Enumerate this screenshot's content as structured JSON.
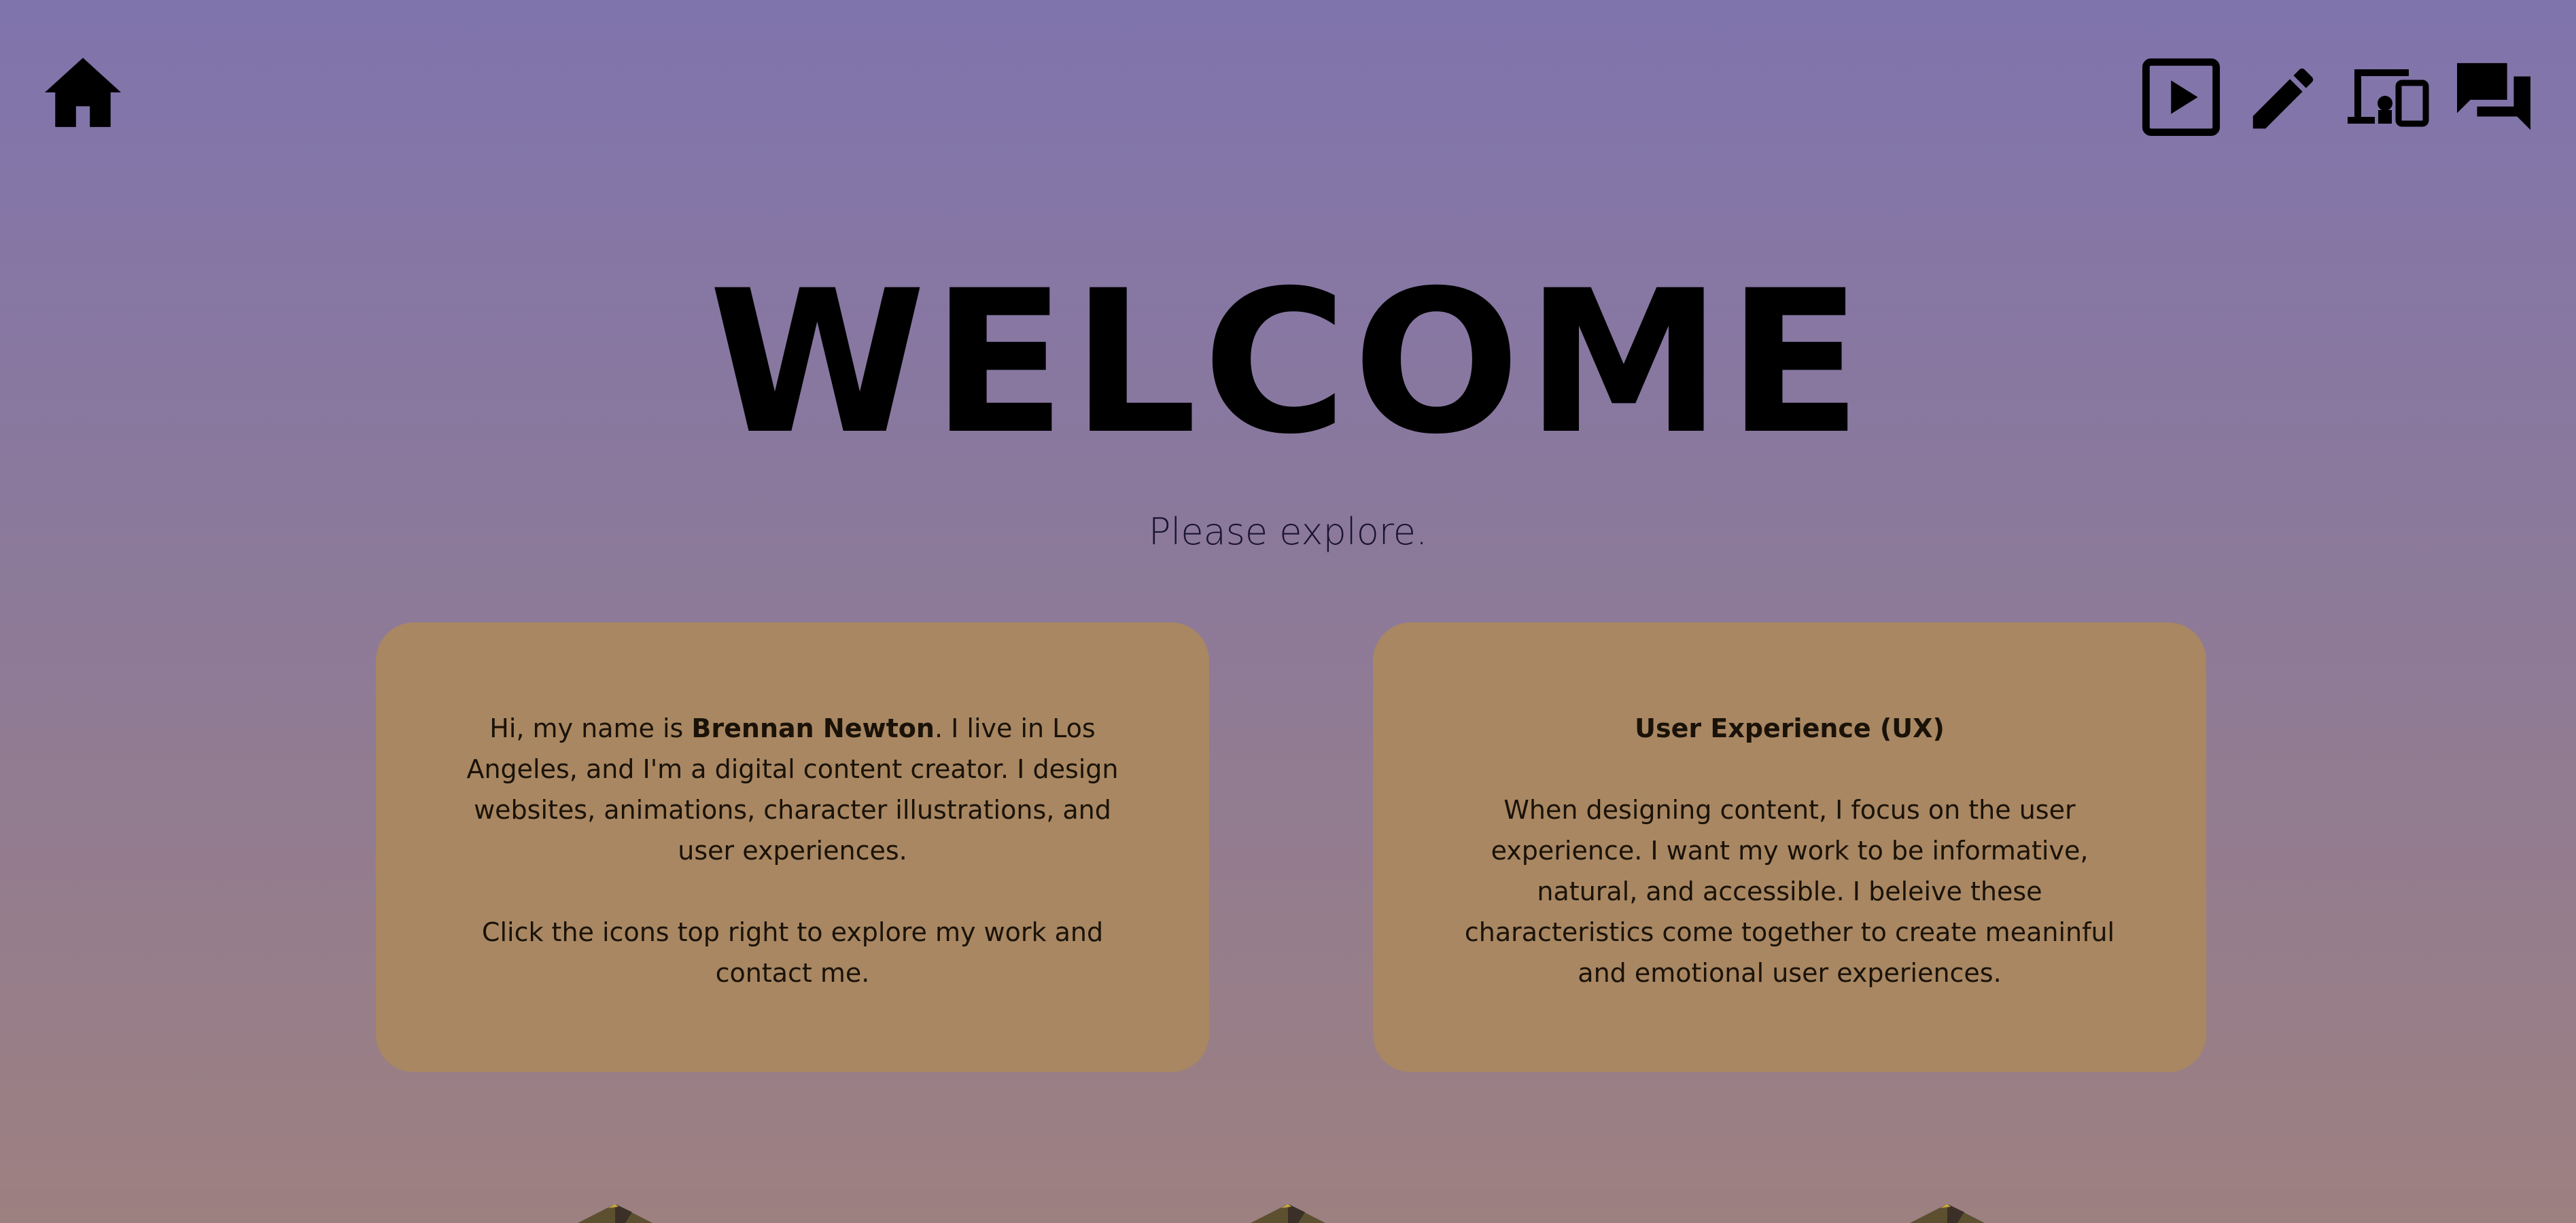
{
  "nav": {
    "home_icon": "home-icon",
    "items": [
      {
        "icon": "play-square-icon",
        "label": "Animations"
      },
      {
        "icon": "pencil-icon",
        "label": "Illustrations"
      },
      {
        "icon": "devices-icon",
        "label": "Websites"
      },
      {
        "icon": "chat-icon",
        "label": "Contact"
      }
    ]
  },
  "hero": {
    "title": "WELCOME",
    "subtitle": "Please explore."
  },
  "cards": {
    "about": {
      "intro_before": "Hi, my name is ",
      "name": "Brennan Newton",
      "intro_after": ". I live in Los Angeles, and I'm a digital content creator. I design websites, animations, character illustrations, and user experiences.",
      "cta": "Click the icons top right to explore my work and contact me."
    },
    "ux": {
      "title": "User Experience (UX)",
      "body": "When designing content, I focus on the user experience. I want my work to be informative, natural, and accessible. I beleive these characteristics come together to create meaninful and emotional user experiences."
    }
  },
  "colors": {
    "gradient_top": "#8074ad",
    "gradient_bottom": "#9d8080",
    "card_bg": "#a88762",
    "text": "#000000"
  }
}
